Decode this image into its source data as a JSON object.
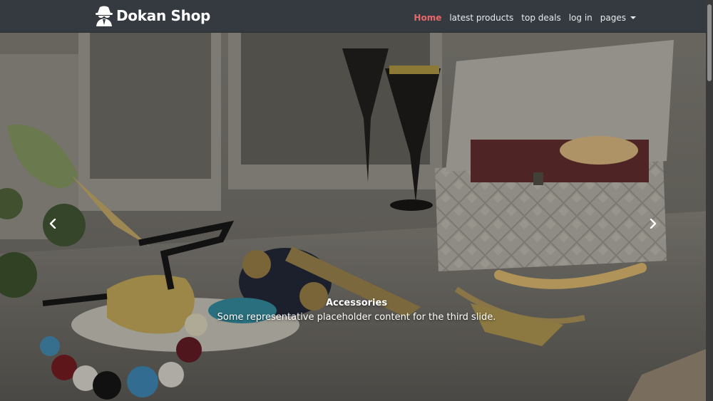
{
  "navbar": {
    "brand": "Dokan Shop",
    "brand_icon": "spy-icon",
    "links": [
      {
        "label": "Home",
        "active": true
      },
      {
        "label": "latest products"
      },
      {
        "label": "top deals"
      },
      {
        "label": "log in"
      },
      {
        "label": "pages",
        "dropdown": true
      }
    ]
  },
  "carousel": {
    "active_slide": 3,
    "caption": {
      "title": "Accessories",
      "text": "Some representative placeholder content for the third slide."
    },
    "prev_icon": "chevron-left-icon",
    "next_icon": "chevron-right-icon"
  },
  "colors": {
    "navbar_bg": "#343a40",
    "active_link": "#e8676b",
    "link": "#e9ecef"
  }
}
